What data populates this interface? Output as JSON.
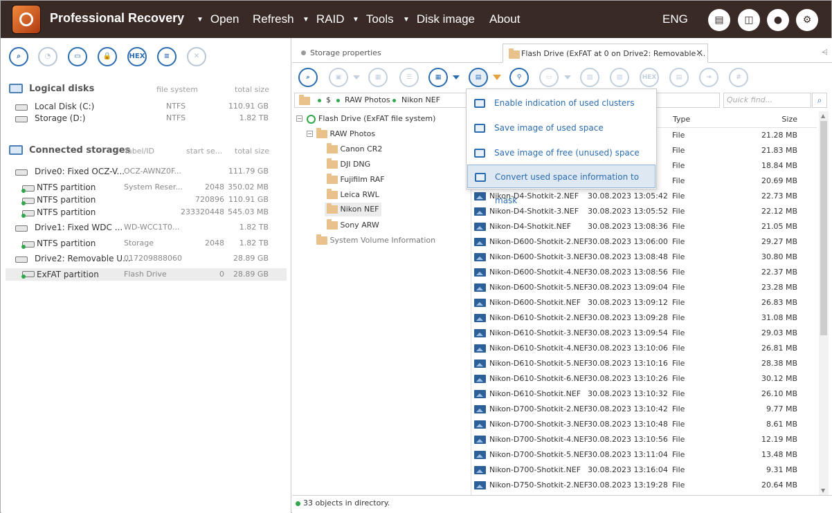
{
  "app": {
    "title": "Professional Recovery",
    "language": "ENG"
  },
  "menu": {
    "open": "Open",
    "refresh": "Refresh",
    "raid": "RAID",
    "tools": "Tools",
    "disk_image": "Disk image",
    "about": "About"
  },
  "left": {
    "tools": [
      "search-icon",
      "chart-icon",
      "open-image-icon",
      "lock-icon",
      "HEX",
      "list-icon",
      "close-icon"
    ],
    "logical": {
      "title": "Logical disks",
      "col_fs": "file system",
      "col_size": "total size",
      "items": [
        {
          "name": "Local Disk (C:)",
          "fs": "NTFS",
          "size": "110.91 GB"
        },
        {
          "name": "Storage (D:)",
          "fs": "NTFS",
          "size": "1.82 TB"
        }
      ]
    },
    "connected": {
      "title": "Connected storages",
      "col_label": "label/ID",
      "col_start": "start se...",
      "col_size": "total size",
      "items": [
        {
          "name": "Drive0: Fixed OCZ-V...",
          "label": "OCZ-AWNZ0F...",
          "start": "",
          "size": "111.79 GB"
        },
        {
          "name": "NTFS partition",
          "label": "System Reser...",
          "start": "2048",
          "size": "350.02 MB"
        },
        {
          "name": "NTFS partition",
          "label": "",
          "start": "720896",
          "size": "110.91 GB"
        },
        {
          "name": "NTFS partition",
          "label": "",
          "start": "233320448",
          "size": "545.03 MB"
        },
        {
          "name": "Drive1: Fixed WDC ...",
          "label": "WD-WCC1T0...",
          "start": "",
          "size": "1.82 TB"
        },
        {
          "name": "NTFS partition",
          "label": "Storage",
          "start": "2048",
          "size": "1.82 TB"
        },
        {
          "name": "Drive2: Removable U...",
          "label": "017209888060",
          "start": "",
          "size": "28.89 GB"
        },
        {
          "name": "ExFAT partition",
          "label": "Flash Drive",
          "start": "0",
          "size": "28.89 GB"
        }
      ]
    }
  },
  "tabs": {
    "storage_properties": "Storage properties",
    "flash_drive": "Flash Drive (ExFAT at 0 on Drive2: Removable ..."
  },
  "toolbar": {
    "hex": "HEX",
    "hash": "#"
  },
  "address": {
    "root": "$",
    "p1": "RAW Photos",
    "p2": "Nikon NEF"
  },
  "search": {
    "placeholder": "Quick find..."
  },
  "tree": {
    "root": "Flash Drive (ExFAT file system)",
    "raw": "RAW Photos",
    "children": [
      "Canon CR2",
      "DJI DNG",
      "Fujifilm RAF",
      "Leica RWL",
      "Nikon NEF",
      "Sony ARW"
    ],
    "svi": "System Volume Information"
  },
  "files": {
    "col_type": "Type",
    "col_size": "Size",
    "rows": [
      {
        "name": "",
        "date": "",
        "type": "File",
        "size": "21.28 MB"
      },
      {
        "name": "",
        "date": "",
        "type": "File",
        "size": "21.83 MB"
      },
      {
        "name": "",
        "date": "",
        "type": "File",
        "size": "18.84 MB"
      },
      {
        "name": "",
        "date": "",
        "type": "File",
        "size": "20.69 MB"
      },
      {
        "name": "Nikon-D4-Shotkit-2.NEF",
        "date": "30.08.2023 13:05:42",
        "type": "File",
        "size": "22.73 MB"
      },
      {
        "name": "Nikon-D4-Shotkit-3.NEF",
        "date": "30.08.2023 13:05:52",
        "type": "File",
        "size": "22.12 MB"
      },
      {
        "name": "Nikon-D4-Shotkit.NEF",
        "date": "30.08.2023 13:08:36",
        "type": "File",
        "size": "21.05 MB"
      },
      {
        "name": "Nikon-D600-Shotkit-2.NEF",
        "date": "30.08.2023 13:06:00",
        "type": "File",
        "size": "29.27 MB"
      },
      {
        "name": "Nikon-D600-Shotkit-3.NEF",
        "date": "30.08.2023 13:08:48",
        "type": "File",
        "size": "30.80 MB"
      },
      {
        "name": "Nikon-D600-Shotkit-4.NEF",
        "date": "30.08.2023 13:08:56",
        "type": "File",
        "size": "22.37 MB"
      },
      {
        "name": "Nikon-D600-Shotkit-5.NEF",
        "date": "30.08.2023 13:09:04",
        "type": "File",
        "size": "23.28 MB"
      },
      {
        "name": "Nikon-D600-Shotkit.NEF",
        "date": "30.08.2023 13:09:12",
        "type": "File",
        "size": "26.83 MB"
      },
      {
        "name": "Nikon-D610-Shotkit-2.NEF",
        "date": "30.08.2023 13:09:28",
        "type": "File",
        "size": "31.08 MB"
      },
      {
        "name": "Nikon-D610-Shotkit-3.NEF",
        "date": "30.08.2023 13:09:54",
        "type": "File",
        "size": "29.03 MB"
      },
      {
        "name": "Nikon-D610-Shotkit-4.NEF",
        "date": "30.08.2023 13:10:06",
        "type": "File",
        "size": "26.81 MB"
      },
      {
        "name": "Nikon-D610-Shotkit-5.NEF",
        "date": "30.08.2023 13:10:16",
        "type": "File",
        "size": "28.38 MB"
      },
      {
        "name": "Nikon-D610-Shotkit-6.NEF",
        "date": "30.08.2023 13:10:26",
        "type": "File",
        "size": "30.12 MB"
      },
      {
        "name": "Nikon-D610-Shotkit.NEF",
        "date": "30.08.2023 13:10:32",
        "type": "File",
        "size": "26.10 MB"
      },
      {
        "name": "Nikon-D700-Shotkit-2.NEF",
        "date": "30.08.2023 13:10:42",
        "type": "File",
        "size": "9.77 MB"
      },
      {
        "name": "Nikon-D700-Shotkit-3.NEF",
        "date": "30.08.2023 13:10:48",
        "type": "File",
        "size": "8.61 MB"
      },
      {
        "name": "Nikon-D700-Shotkit-4.NEF",
        "date": "30.08.2023 13:10:56",
        "type": "File",
        "size": "12.19 MB"
      },
      {
        "name": "Nikon-D700-Shotkit-5.NEF",
        "date": "30.08.2023 13:11:04",
        "type": "File",
        "size": "13.48 MB"
      },
      {
        "name": "Nikon-D700-Shotkit.NEF",
        "date": "30.08.2023 13:16:04",
        "type": "File",
        "size": "9.31 MB"
      },
      {
        "name": "Nikon-D750-Shotkit-2.NEF",
        "date": "30.08.2023 13:19:28",
        "type": "File",
        "size": "20.64 MB"
      }
    ]
  },
  "popup": {
    "items": [
      "Enable indication of used clusters",
      "Save image of used space",
      "Save image of free (unused) space",
      "Convert used space information to mask"
    ]
  },
  "status": {
    "text": "33 objects in directory."
  },
  "colors": {
    "titlebar": "#3a2a26",
    "accent": "#2b6cb0",
    "ok": "#2ea84a"
  }
}
